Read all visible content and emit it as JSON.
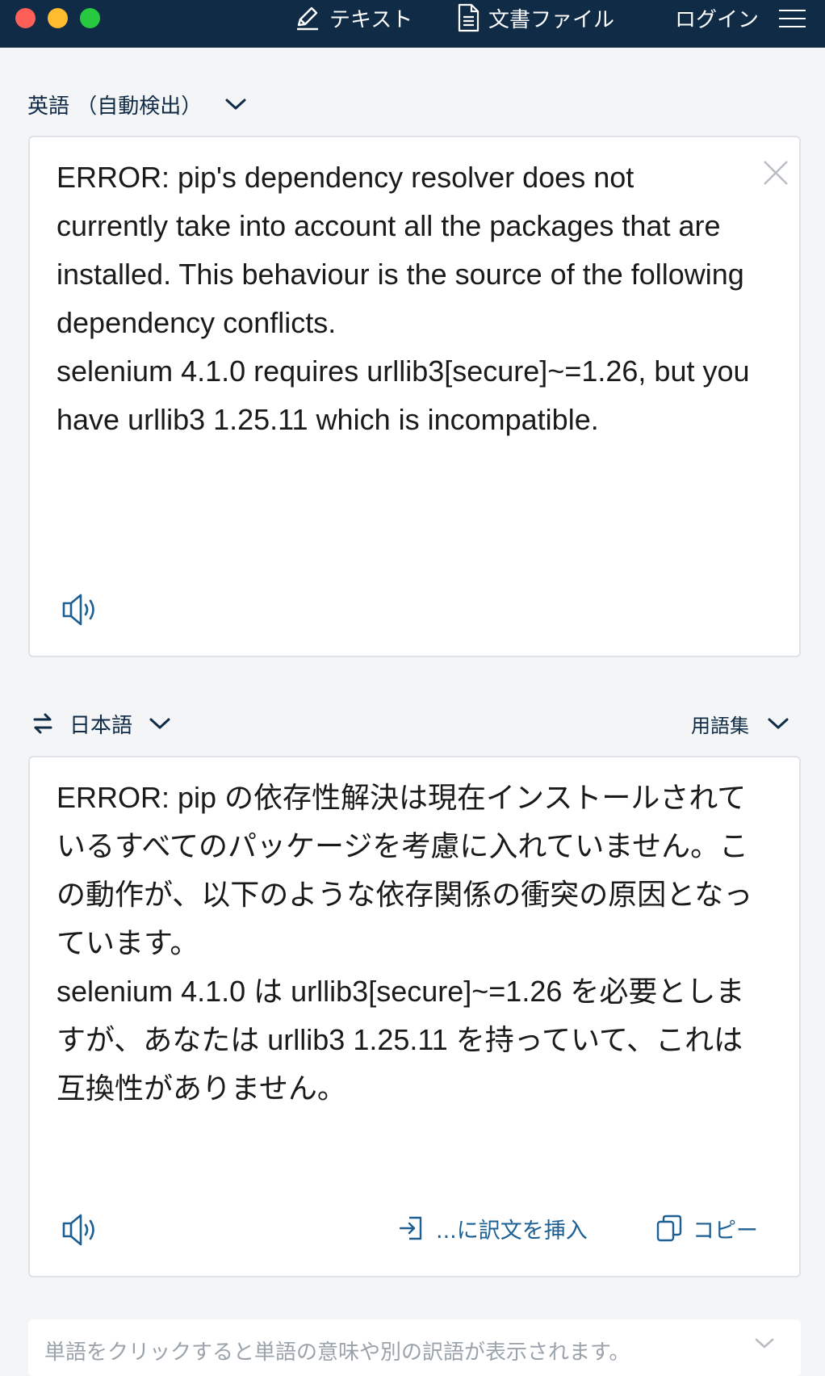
{
  "nav": {
    "text_tab": "テキスト",
    "document_tab": "文書ファイル",
    "login": "ログイン"
  },
  "source": {
    "language": "英語 （自動検出）",
    "text": "ERROR: pip's dependency resolver does not currently take into account all the packages that are installed. This behaviour is the source of the following dependency conflicts.\nselenium 4.1.0 requires urllib3[secure]~=1.26, but you have urllib3 1.25.11 which is incompatible."
  },
  "target": {
    "language": "日本語",
    "glossary": "用語集",
    "text": "ERROR: pip の依存性解決は現在インストールされているすべてのパッケージを考慮に入れていません。この動作が、以下のような依存関係の衝突の原因となっています。\nselenium 4.1.0 は urllib3[secure]~=1.26 を必要としますが、あなたは urllib3 1.25.11 を持っていて、これは互換性がありません。",
    "insert_label": "...に訳文を挿入",
    "copy_label": "コピー"
  },
  "hint": {
    "text": "単語をクリックすると単語の意味や別の訳語が表示されます。"
  },
  "colors": {
    "topbar": "#0f2b46",
    "accent": "#1c5f93",
    "background": "#f4f5f6"
  },
  "icons": [
    "pencil-icon",
    "document-icon",
    "hamburger-icon",
    "chevron-down-icon",
    "close-icon",
    "speaker-icon",
    "swap-icon",
    "insert-icon",
    "copy-icon"
  ]
}
